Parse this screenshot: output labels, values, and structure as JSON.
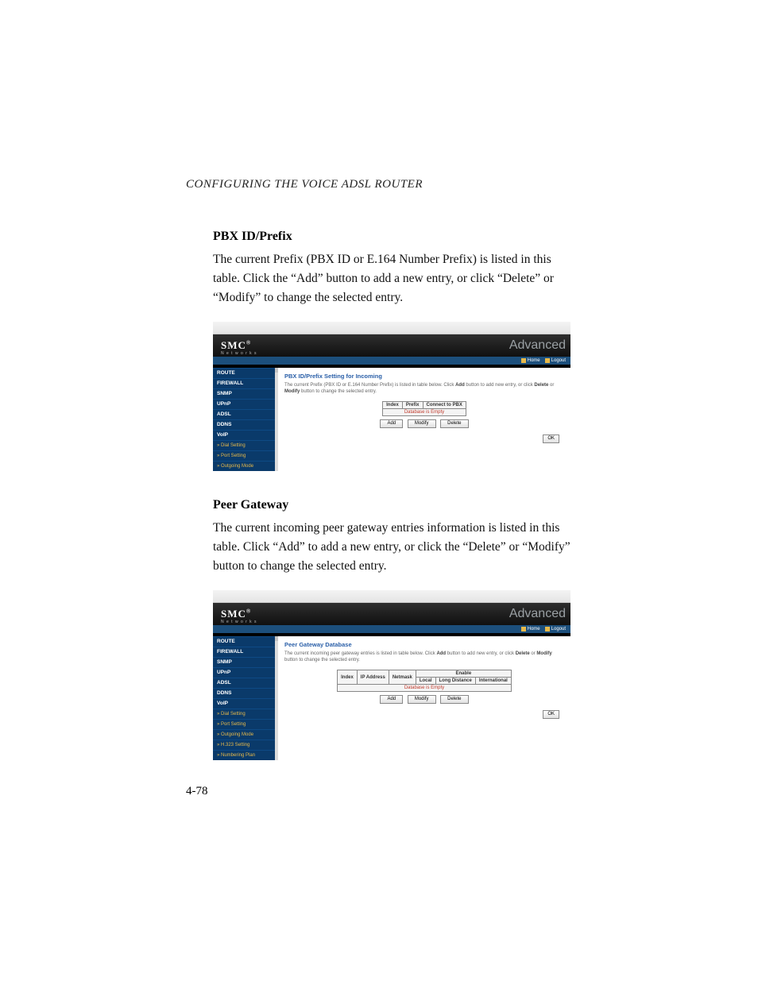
{
  "running_head": "CONFIGURING THE VOICE ADSL ROUTER",
  "page_number": "4-78",
  "sections": [
    {
      "title": "PBX ID/Prefix",
      "body": "The current Prefix (PBX ID or E.164 Number Prefix) is listed in this table. Click the “Add” button to add a new entry, or click “Delete” or “Modify” to change the selected entry."
    },
    {
      "title": "Peer Gateway",
      "body": "The current incoming peer gateway entries information is listed in this table. Click “Add” to add a new entry, or click the “Delete” or “Modify” button to change the selected entry."
    }
  ],
  "shared": {
    "logo": "SMC",
    "logo_reg": "®",
    "logo_sub": "N e t w o r k s",
    "brand_right": "Advanced",
    "home": "Home",
    "logout": "Logout",
    "empty": "Database is Empty",
    "add": "Add",
    "modify": "Modify",
    "delete": "Delete",
    "ok": "OK"
  },
  "shot1": {
    "heading": "PBX ID/Prefix Setting for Incoming",
    "desc_pre": "The current Prefix (PBX ID or E.164 Number Prefix) is listed in table below. Click ",
    "desc_add": "Add",
    "desc_mid": " button to add new entry, or click ",
    "desc_del": "Delete",
    "desc_or": " or ",
    "desc_mod": "Modify",
    "desc_post": " button to change the selected entry.",
    "cols": {
      "c1": "Index",
      "c2": "Prefix",
      "c3": "Connect to PBX"
    },
    "side": {
      "i1": "ROUTE",
      "i2": "FIREWALL",
      "i3": "SNMP",
      "i4": "UPnP",
      "i5": "ADSL",
      "i6": "DDNS",
      "i7": "VoIP",
      "s1": "» Dial Setting",
      "s2": "» Port Setting",
      "s3": "» Outgoing Mode"
    }
  },
  "shot2": {
    "heading": "Peer Gateway Database",
    "desc_pre": "The current incoming peer gateway entries is listed in table below. Click ",
    "desc_add": "Add",
    "desc_mid": " button to add new entry, or click ",
    "desc_del": "Delete",
    "desc_or": " or ",
    "desc_mod": "Modify",
    "desc_post": " button to change the selected entry.",
    "cols": {
      "c1": "Index",
      "c2": "IP Address",
      "c3": "Netmask",
      "enable": "Enable",
      "e1": "Local",
      "e2": "Long Distance",
      "e3": "International"
    },
    "side": {
      "i1": "ROUTE",
      "i2": "FIREWALL",
      "i3": "SNMP",
      "i4": "UPnP",
      "i5": "ADSL",
      "i6": "DDNS",
      "i7": "VoIP",
      "s1": "» Dial Setting",
      "s2": "» Port Setting",
      "s3": "» Outgoing Mode",
      "s4": "» H.323 Setting",
      "s5": "» Numbering Plan"
    }
  }
}
